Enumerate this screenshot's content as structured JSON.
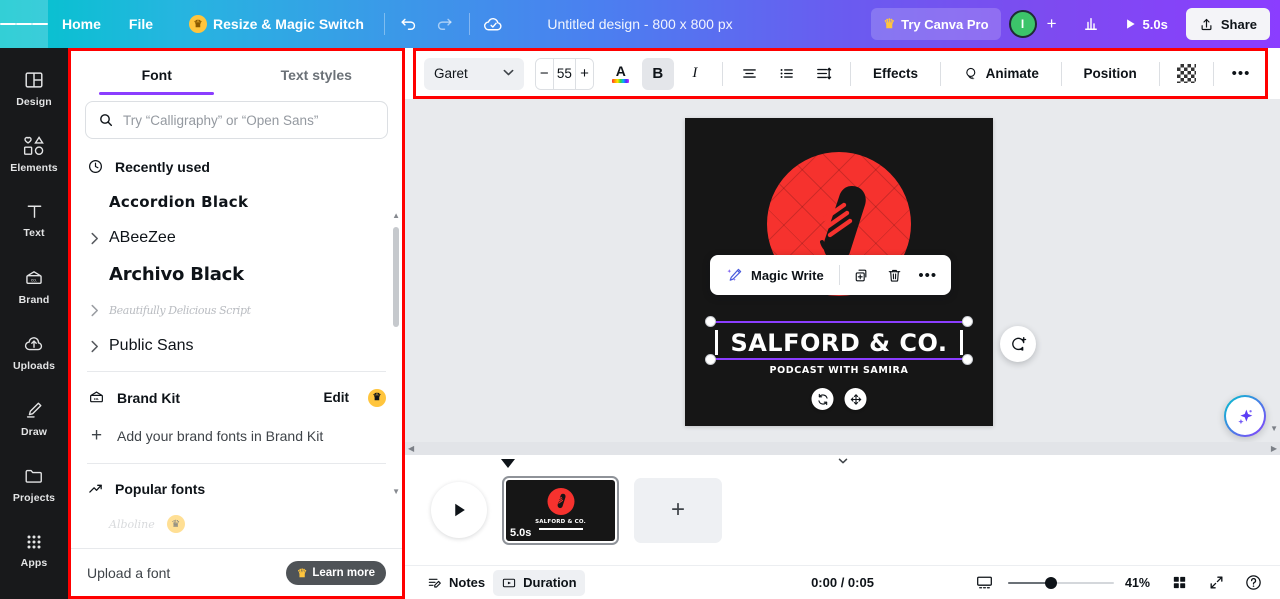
{
  "topbar": {
    "menu_icon": "hamburger-icon",
    "home": "Home",
    "file": "File",
    "resize": "Resize & Magic Switch",
    "crown": "♛",
    "undo_icon": "undo-icon",
    "redo_icon": "redo-icon",
    "cloud_icon": "cloud-saved-icon",
    "title": "Untitled design - 800 x 800 px",
    "try_pro": "Try Canva Pro",
    "avatar_initial": "I",
    "add_people": "+",
    "insights_icon": "insights-icon",
    "duration": "5.0s",
    "share": "Share"
  },
  "sidebar": {
    "items": [
      {
        "label": "Design",
        "icon": "design-icon"
      },
      {
        "label": "Elements",
        "icon": "elements-icon"
      },
      {
        "label": "Text",
        "icon": "text-icon"
      },
      {
        "label": "Brand",
        "icon": "brand-icon"
      },
      {
        "label": "Uploads",
        "icon": "uploads-icon"
      },
      {
        "label": "Draw",
        "icon": "draw-icon"
      },
      {
        "label": "Projects",
        "icon": "projects-icon"
      },
      {
        "label": "Apps",
        "icon": "apps-icon"
      }
    ]
  },
  "panel": {
    "tabs": [
      {
        "label": "Font",
        "active": true
      },
      {
        "label": "Text styles",
        "active": false
      }
    ],
    "search": {
      "placeholder": "Try “Calligraphy” or “Open Sans”",
      "value": "",
      "icon": "search-icon"
    },
    "recently_used": {
      "label": "Recently used",
      "icon": "clock-icon",
      "fonts": [
        {
          "name": "Accordion Black",
          "expandable": false
        },
        {
          "name": "ABeeZee",
          "expandable": true
        },
        {
          "name": "Archivo Black",
          "expandable": false
        },
        {
          "name": "Beautifully Delicious Script",
          "expandable": true
        },
        {
          "name": "Public Sans",
          "expandable": true
        }
      ]
    },
    "brand_kit": {
      "label": "Brand Kit",
      "icon": "brand-kit-icon",
      "edit": "Edit",
      "crown": "♛",
      "add_fonts": "Add your brand fonts in Brand Kit",
      "plus": "+"
    },
    "popular_fonts": {
      "label": "Popular fonts",
      "icon": "trending-icon",
      "fonts": [
        {
          "name": "Alboline",
          "crown": "♛"
        }
      ]
    },
    "footer": {
      "upload": "Upload a font",
      "learn_more": "Learn more",
      "crown": "♛"
    }
  },
  "toolbar": {
    "font_family": "Garet",
    "caret_icon": "chevron-down-icon",
    "decrease": "−",
    "font_size": "55",
    "increase": "+",
    "text_color_icon": "text-color-icon",
    "bold": "B",
    "italic": "I",
    "align_icon": "align-center-icon",
    "list_icon": "bullet-list-icon",
    "spacing_icon": "line-spacing-icon",
    "effects": "Effects",
    "animate": "Animate",
    "animate_icon": "animate-icon",
    "position": "Position",
    "transparency_icon": "transparency-icon",
    "more": "•••"
  },
  "canvas": {
    "design": {
      "title": "SALFORD & CO.",
      "subtitle": "PODCAST WITH SAMIRA",
      "accent_color": "#f6322e",
      "background_color": "#161616"
    },
    "float_toolbar": {
      "magic_write": "Magic Write",
      "magic_icon": "magic-pen-icon",
      "duplicate_icon": "duplicate-icon",
      "delete_icon": "trash-icon",
      "more": "•••"
    },
    "object_actions": {
      "rotate_icon": "rotate-icon",
      "move_icon": "move-icon"
    },
    "comment_icon": "add-comment-icon",
    "magic_studio_icon": "magic-studio-sparkle-icon"
  },
  "timeline": {
    "collapse_icon": "chevron-down-icon",
    "play_icon": "play-icon",
    "page_thumb": {
      "duration": "5.0s",
      "title": "SALFORD & CO."
    },
    "add_page": "+"
  },
  "bottombar": {
    "notes": "Notes",
    "notes_icon": "notes-icon",
    "duration": "Duration",
    "duration_icon": "duration-icon",
    "time": "0:00 / 0:05",
    "fit_icon": "fit-screen-icon",
    "zoom_percent": "41%",
    "grid_icon": "grid-view-icon",
    "fullscreen_icon": "fullscreen-icon",
    "help_icon": "help-icon"
  },
  "colors": {
    "accent_purple": "#8b3dff",
    "highlight_red": "#ff0000",
    "brand_teal": "#00c4cc",
    "canvas_red": "#f6322e"
  }
}
